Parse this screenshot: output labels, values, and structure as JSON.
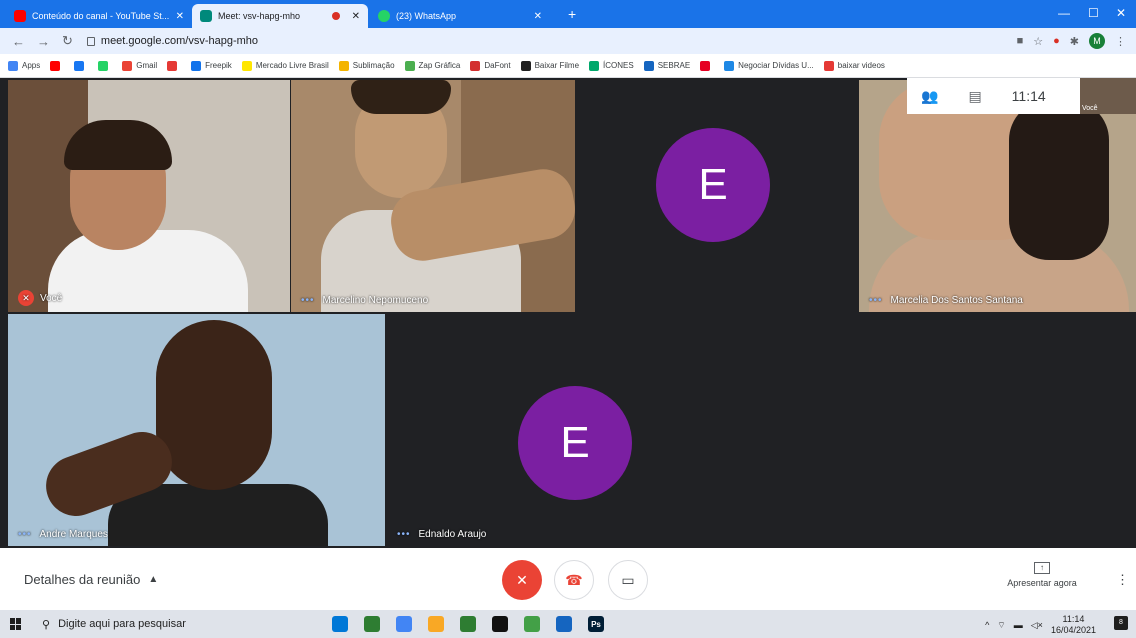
{
  "browser": {
    "tabs": [
      {
        "label": "Conteúdo do canal - YouTube St...",
        "favicon_color": "#ff0000"
      },
      {
        "label": "Meet: vsv-hapg-mho",
        "favicon_color": "#00897b"
      },
      {
        "label": "(23) WhatsApp",
        "favicon_color": "#25d366"
      }
    ],
    "url": "meet.google.com/vsv-hapg-mho",
    "profile_initial": "M",
    "bookmarks": [
      {
        "label": "Apps",
        "color": "#4285f4"
      },
      {
        "label": "",
        "color": "#ff0000"
      },
      {
        "label": "",
        "color": "#1877f2"
      },
      {
        "label": "",
        "color": "#25d366"
      },
      {
        "label": "Gmail",
        "color": "#ea4335"
      },
      {
        "label": "",
        "color": "#e53935"
      },
      {
        "label": "Freepik",
        "color": "#1273eb"
      },
      {
        "label": "Mercado Livre Brasil",
        "color": "#ffe600"
      },
      {
        "label": "Sublimação",
        "color": "#f4b400"
      },
      {
        "label": "Zap Gráfica",
        "color": "#4caf50"
      },
      {
        "label": "DaFont",
        "color": "#d32f2f"
      },
      {
        "label": "Baixar Filme",
        "color": "#212121"
      },
      {
        "label": "ÍCONES",
        "color": "#00a86b"
      },
      {
        "label": "SEBRAE",
        "color": "#1565c0"
      },
      {
        "label": "",
        "color": "#e60023"
      },
      {
        "label": "Negociar Dívidas U...",
        "color": "#1e88e5"
      },
      {
        "label": "baixar videos",
        "color": "#e53935"
      }
    ]
  },
  "meet": {
    "clock": "11:14",
    "self_label": "Você",
    "participants": [
      {
        "name": "Você",
        "muted": true
      },
      {
        "name": "Marcelino Nepomuceno",
        "muted": false
      },
      {
        "name": "",
        "avatar_letter": "E"
      },
      {
        "name": "Marcelia Dos Santos Santana",
        "muted": false
      },
      {
        "name": "Andre Marques",
        "muted": false
      },
      {
        "name": "Ednaldo Araujo",
        "avatar_letter": "E"
      }
    ],
    "details_label": "Detalhes da reunião",
    "present_label": "Apresentar agora",
    "avatar_color": "#7b1fa2",
    "hangup_color": "#ea4335"
  },
  "taskbar": {
    "search_placeholder": "Digite aqui para pesquisar",
    "time": "11:14",
    "date": "16/04/2021",
    "notifications": "8",
    "apps": [
      {
        "label": "",
        "color": "#0078d7"
      },
      {
        "label": "",
        "color": "#2e7d32"
      },
      {
        "label": "",
        "color": "#4285f4"
      },
      {
        "label": "",
        "color": "#f9a825"
      },
      {
        "label": "",
        "color": "#2e7d32"
      },
      {
        "label": "",
        "color": "#111111"
      },
      {
        "label": "",
        "color": "#43a047"
      },
      {
        "label": "",
        "color": "#1565c0"
      },
      {
        "label": "Ps",
        "color": "#001e36"
      }
    ]
  }
}
